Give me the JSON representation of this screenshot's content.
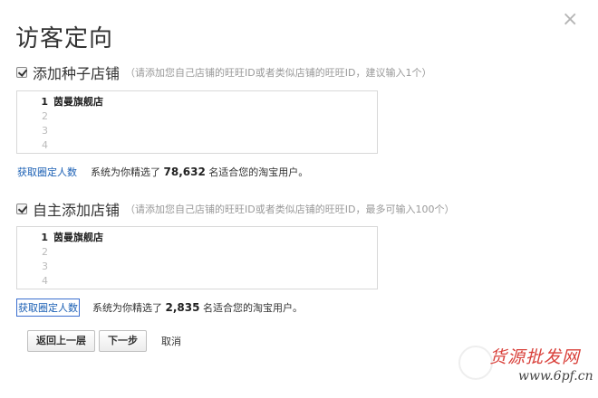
{
  "dialog": {
    "title": "访客定向",
    "close_glyph": "×"
  },
  "seed_section": {
    "title": "添加种子店铺",
    "hint": "（请添加您自己店铺的旺旺ID或者类似店铺的旺旺ID，建议输入1个）",
    "lines": [
      {
        "num": "1",
        "text": "茵曼旗舰店"
      },
      {
        "num": "2",
        "text": ""
      },
      {
        "num": "3",
        "text": ""
      },
      {
        "num": "4",
        "text": ""
      }
    ],
    "link": "获取圈定人数",
    "stat_prefix": "系统为你精选了",
    "stat_count": "78,632",
    "stat_suffix": "名适合您的淘宝用户。"
  },
  "custom_section": {
    "title": "自主添加店铺",
    "hint": "（请添加您自己店铺的旺旺ID或者类似店铺的旺旺ID，最多可输入100个）",
    "lines": [
      {
        "num": "1",
        "text": "茵曼旗舰店"
      },
      {
        "num": "2",
        "text": ""
      },
      {
        "num": "3",
        "text": ""
      },
      {
        "num": "4",
        "text": ""
      }
    ],
    "link": "获取圈定人数",
    "stat_prefix": "系统为你精选了",
    "stat_count": "2,835",
    "stat_suffix": "名适合您的淘宝用户。"
  },
  "actions": {
    "back": "返回上一层",
    "next": "下一步",
    "cancel": "取消"
  },
  "watermark": {
    "line1": "货源批发网",
    "line2": "www.6pf.cn"
  }
}
